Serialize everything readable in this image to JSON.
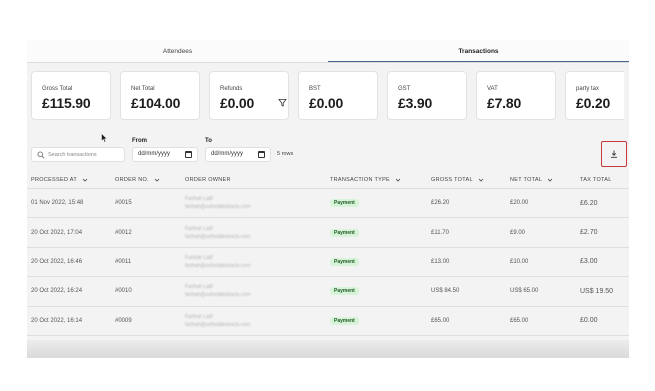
{
  "tabs": [
    {
      "label": "Attendees",
      "active": false
    },
    {
      "label": "Transactions",
      "active": true
    }
  ],
  "cards": [
    {
      "label": "Gross Total",
      "value": "£115.90"
    },
    {
      "label": "Net Total",
      "value": "£104.00"
    },
    {
      "label": "Refunds",
      "value": "£0.00",
      "icon": "filter-icon"
    },
    {
      "label": "BST",
      "value": "£0.00"
    },
    {
      "label": "GST",
      "value": "£3.90"
    },
    {
      "label": "VAT",
      "value": "£7.80"
    },
    {
      "label": "party tax",
      "value": "£0.20"
    }
  ],
  "filters": {
    "search_placeholder": "Search transactions",
    "from_label": "From",
    "to_label": "To",
    "from_value": "dd/mm/yyyy",
    "to_value": "dd/mm/yyyy",
    "rows_text": "5 rows",
    "download_icon": "download-icon"
  },
  "table": {
    "headers": [
      "PROCESSED AT",
      "ORDER NO.",
      "ORDER OWNER",
      "TRANSACTION TYPE",
      "GROSS TOTAL",
      "NET TOTAL",
      "TAX TOTAL"
    ],
    "rows": [
      {
        "processed": "01 Nov 2022, 15:48",
        "order": "#0015",
        "owner_name": "Farihah Latif",
        "owner_email": "farihah@oxfordabstracts.com",
        "type": "Payment",
        "gross": "£26.20",
        "net": "£20.00",
        "tax": "£6.20"
      },
      {
        "processed": "20 Oct 2022, 17:04",
        "order": "#0012",
        "owner_name": "Farihah Latif",
        "owner_email": "farihah@oxfordabstracts.com",
        "type": "Payment",
        "gross": "£11.70",
        "net": "£9.00",
        "tax": "£2.70"
      },
      {
        "processed": "20 Oct 2022, 16:46",
        "order": "#0011",
        "owner_name": "Farihah Latif",
        "owner_email": "farihah@oxfordabstracts.com",
        "type": "Payment",
        "gross": "£13.00",
        "net": "£10.00",
        "tax": "£3.00"
      },
      {
        "processed": "20 Oct 2022, 16:24",
        "order": "#0010",
        "owner_name": "Farihah Latif",
        "owner_email": "farihah@oxfordabstracts.com",
        "type": "Payment",
        "gross": "US$ 84.50",
        "net": "US$ 65.00",
        "tax": "US$ 19.50"
      },
      {
        "processed": "20 Oct 2022, 16:14",
        "order": "#0009",
        "owner_name": "Farihah Latif",
        "owner_email": "farihah@oxfordabstracts.com",
        "type": "Payment",
        "gross": "£65.00",
        "net": "£65.00",
        "tax": "£0.00"
      }
    ]
  },
  "colors": {
    "tab_accent": "#46668f",
    "badge_bg": "#d7f3d8",
    "badge_text": "#1f5a25",
    "download_border": "#c83a3a"
  }
}
